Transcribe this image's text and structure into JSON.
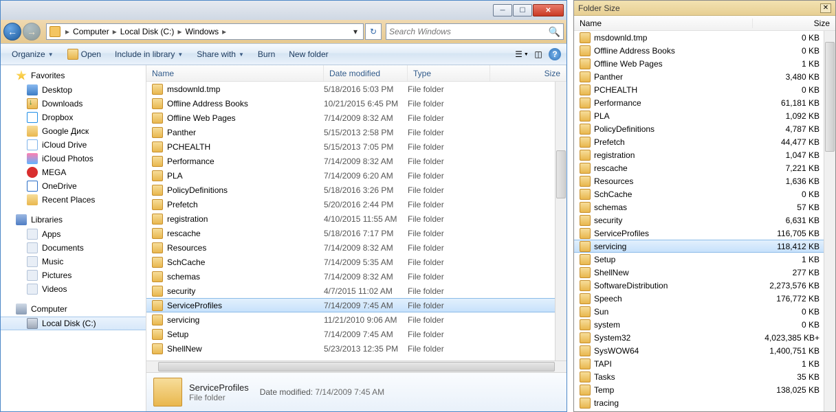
{
  "breadcrumb": {
    "root": "Computer",
    "drive": "Local Disk (C:)",
    "folder": "Windows"
  },
  "search": {
    "placeholder": "Search Windows"
  },
  "toolbar": {
    "organize": "Organize",
    "open": "Open",
    "include": "Include in library",
    "share": "Share with",
    "burn": "Burn",
    "new_folder": "New folder"
  },
  "nav": {
    "favorites": "Favorites",
    "fav_items": [
      {
        "icon": "i-desktop",
        "label": "Desktop"
      },
      {
        "icon": "i-dl",
        "label": "Downloads"
      },
      {
        "icon": "i-db",
        "label": "Dropbox"
      },
      {
        "icon": "i-gd",
        "label": "Google Диск"
      },
      {
        "icon": "i-ic",
        "label": "iCloud Drive"
      },
      {
        "icon": "i-ip",
        "label": "iCloud Photos"
      },
      {
        "icon": "i-mega",
        "label": "MEGA"
      },
      {
        "icon": "i-od",
        "label": "OneDrive"
      },
      {
        "icon": "i-rp",
        "label": "Recent Places"
      }
    ],
    "libraries": "Libraries",
    "lib_items": [
      {
        "icon": "i-apps",
        "label": "Apps"
      },
      {
        "icon": "i-docs",
        "label": "Documents"
      },
      {
        "icon": "i-music",
        "label": "Music"
      },
      {
        "icon": "i-pics",
        "label": "Pictures"
      },
      {
        "icon": "i-vids",
        "label": "Videos"
      }
    ],
    "computer": "Computer",
    "local_disk": "Local Disk (C:)"
  },
  "columns": {
    "name": "Name",
    "date": "Date modified",
    "type": "Type",
    "size": "Size"
  },
  "files": [
    {
      "name": "msdownld.tmp",
      "date": "5/18/2016 5:03 PM",
      "type": "File folder"
    },
    {
      "name": "Offline Address Books",
      "date": "10/21/2015 6:45 PM",
      "type": "File folder"
    },
    {
      "name": "Offline Web Pages",
      "date": "7/14/2009 8:32 AM",
      "type": "File folder"
    },
    {
      "name": "Panther",
      "date": "5/15/2013 2:58 PM",
      "type": "File folder"
    },
    {
      "name": "PCHEALTH",
      "date": "5/15/2013 7:05 PM",
      "type": "File folder"
    },
    {
      "name": "Performance",
      "date": "7/14/2009 8:32 AM",
      "type": "File folder"
    },
    {
      "name": "PLA",
      "date": "7/14/2009 6:20 AM",
      "type": "File folder"
    },
    {
      "name": "PolicyDefinitions",
      "date": "5/18/2016 3:26 PM",
      "type": "File folder"
    },
    {
      "name": "Prefetch",
      "date": "5/20/2016 2:44 PM",
      "type": "File folder"
    },
    {
      "name": "registration",
      "date": "4/10/2015 11:55 AM",
      "type": "File folder"
    },
    {
      "name": "rescache",
      "date": "5/18/2016 7:17 PM",
      "type": "File folder"
    },
    {
      "name": "Resources",
      "date": "7/14/2009 8:32 AM",
      "type": "File folder"
    },
    {
      "name": "SchCache",
      "date": "7/14/2009 5:35 AM",
      "type": "File folder"
    },
    {
      "name": "schemas",
      "date": "7/14/2009 8:32 AM",
      "type": "File folder"
    },
    {
      "name": "security",
      "date": "4/7/2015 11:02 AM",
      "type": "File folder"
    },
    {
      "name": "ServiceProfiles",
      "date": "7/14/2009 7:45 AM",
      "type": "File folder",
      "selected": true
    },
    {
      "name": "servicing",
      "date": "11/21/2010 9:06 AM",
      "type": "File folder"
    },
    {
      "name": "Setup",
      "date": "7/14/2009 7:45 AM",
      "type": "File folder"
    },
    {
      "name": "ShellNew",
      "date": "5/23/2013 12:35 PM",
      "type": "File folder"
    }
  ],
  "details": {
    "name": "ServiceProfiles",
    "type": "File folder",
    "mod_label": "Date modified:",
    "mod_value": "7/14/2009 7:45 AM"
  },
  "fs": {
    "title": "Folder Size",
    "col_name": "Name",
    "col_size": "Size",
    "items": [
      {
        "name": "msdownld.tmp",
        "size": "0 KB"
      },
      {
        "name": "Offline Address Books",
        "size": "0 KB"
      },
      {
        "name": "Offline Web Pages",
        "size": "1 KB"
      },
      {
        "name": "Panther",
        "size": "3,480 KB"
      },
      {
        "name": "PCHEALTH",
        "size": "0 KB"
      },
      {
        "name": "Performance",
        "size": "61,181 KB"
      },
      {
        "name": "PLA",
        "size": "1,092 KB"
      },
      {
        "name": "PolicyDefinitions",
        "size": "4,787 KB"
      },
      {
        "name": "Prefetch",
        "size": "44,477 KB"
      },
      {
        "name": "registration",
        "size": "1,047 KB"
      },
      {
        "name": "rescache",
        "size": "7,221 KB"
      },
      {
        "name": "Resources",
        "size": "1,636 KB"
      },
      {
        "name": "SchCache",
        "size": "0 KB"
      },
      {
        "name": "schemas",
        "size": "57 KB"
      },
      {
        "name": "security",
        "size": "6,631 KB"
      },
      {
        "name": "ServiceProfiles",
        "size": "116,705 KB"
      },
      {
        "name": "servicing",
        "size": "118,412 KB",
        "selected": true
      },
      {
        "name": "Setup",
        "size": "1 KB"
      },
      {
        "name": "ShellNew",
        "size": "277 KB"
      },
      {
        "name": "SoftwareDistribution",
        "size": "2,273,576 KB"
      },
      {
        "name": "Speech",
        "size": "176,772 KB"
      },
      {
        "name": "Sun",
        "size": "0 KB"
      },
      {
        "name": "system",
        "size": "0 KB"
      },
      {
        "name": "System32",
        "size": "4,023,385 KB+"
      },
      {
        "name": "SysWOW64",
        "size": "1,400,751 KB"
      },
      {
        "name": "TAPI",
        "size": "1 KB"
      },
      {
        "name": "Tasks",
        "size": "35 KB"
      },
      {
        "name": "Temp",
        "size": "138,025 KB"
      },
      {
        "name": "tracing",
        "size": ""
      }
    ]
  }
}
